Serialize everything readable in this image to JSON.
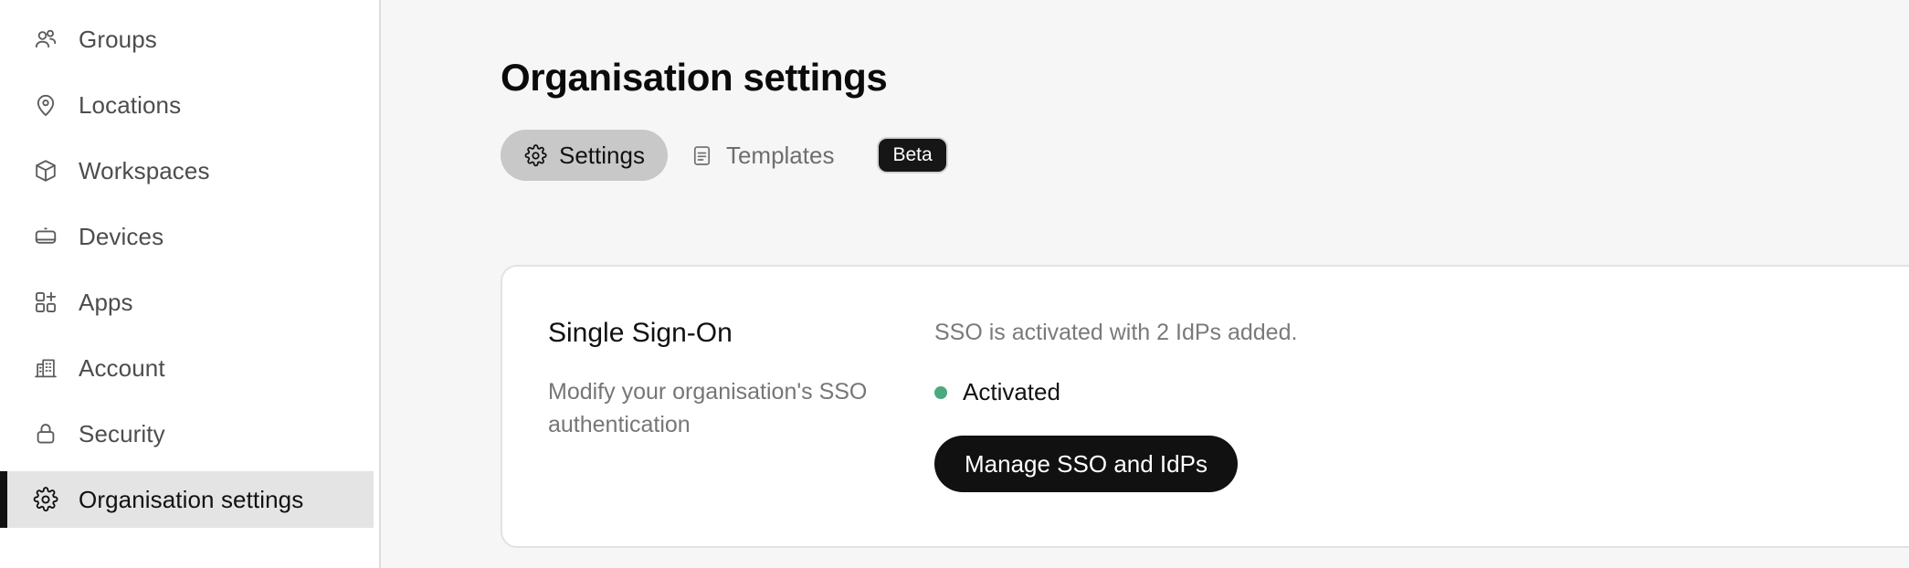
{
  "sidebar": {
    "items": [
      {
        "id": "groups",
        "label": "Groups",
        "icon": "users-icon",
        "active": false
      },
      {
        "id": "locations",
        "label": "Locations",
        "icon": "map-pin-icon",
        "active": false
      },
      {
        "id": "workspaces",
        "label": "Workspaces",
        "icon": "cube-icon",
        "active": false
      },
      {
        "id": "devices",
        "label": "Devices",
        "icon": "device-icon",
        "active": false
      },
      {
        "id": "apps",
        "label": "Apps",
        "icon": "apps-add-icon",
        "active": false
      },
      {
        "id": "account",
        "label": "Account",
        "icon": "building-icon",
        "active": false
      },
      {
        "id": "security",
        "label": "Security",
        "icon": "lock-icon",
        "active": false
      },
      {
        "id": "org-settings",
        "label": "Organisation settings",
        "icon": "gear-icon",
        "active": true
      }
    ]
  },
  "header": {
    "title": "Organisation settings"
  },
  "tabs": [
    {
      "id": "settings",
      "label": "Settings",
      "icon": "gear-icon",
      "active": true,
      "badge": null
    },
    {
      "id": "templates",
      "label": "Templates",
      "icon": "document-icon",
      "active": false,
      "badge": "Beta"
    }
  ],
  "card": {
    "heading": "Single Sign-On",
    "description": "Modify your organisation's SSO authentication",
    "status_summary": "SSO is activated with 2 IdPs added.",
    "status_label": "Activated",
    "status_color": "#4ca97f",
    "button_label": "Manage SSO and IdPs"
  },
  "colors": {
    "accent": "#111111",
    "status_activated": "#4ca97f",
    "main_bg": "#f6f6f6",
    "active_nav_bg": "#e4e4e4",
    "active_tab_bg": "#c8c8c8"
  }
}
